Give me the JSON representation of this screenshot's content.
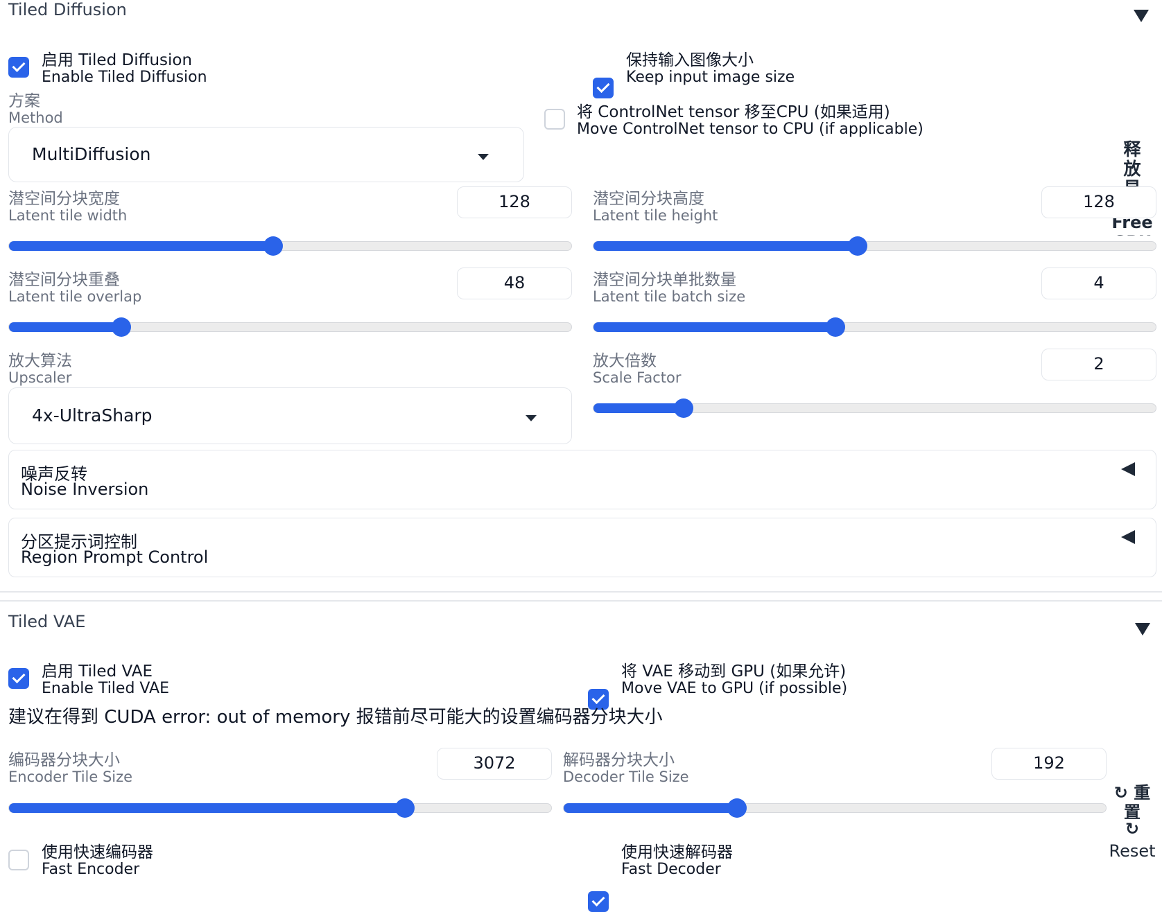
{
  "tiled_diffusion": {
    "title": "Tiled Diffusion",
    "enable": {
      "cn": "启用 Tiled Diffusion",
      "en": "Enable Tiled Diffusion",
      "checked": true
    },
    "keep_size": {
      "cn": "保持输入图像大小",
      "en": "Keep input image size",
      "checked": true
    },
    "controlnet_cpu": {
      "cn": "将 ControlNet tensor 移至CPU (如果适用)",
      "en": "Move ControlNet tensor to CPU (if applicable)",
      "checked": false
    },
    "method": {
      "cn": "方案",
      "en": "Method",
      "value": "MultiDiffusion"
    },
    "free_gpu": {
      "cn": "释放显",
      "en": "Free GPU"
    },
    "tile_width": {
      "cn": "潜空间分块宽度",
      "en": "Latent tile width",
      "value": "128",
      "fraction": 0.47
    },
    "tile_height": {
      "cn": "潜空间分块高度",
      "en": "Latent tile height",
      "value": "128",
      "fraction": 0.47
    },
    "tile_overlap": {
      "cn": "潜空间分块重叠",
      "en": "Latent tile overlap",
      "value": "48",
      "fraction": 0.2
    },
    "batch_size": {
      "cn": "潜空间分块单批数量",
      "en": "Latent tile batch size",
      "value": "4",
      "fraction": 0.43
    },
    "upscaler": {
      "cn": "放大算法",
      "en": "Upscaler",
      "value": "4x-UltraSharp"
    },
    "scale_factor": {
      "cn": "放大倍数",
      "en": "Scale Factor",
      "value": "2",
      "fraction": 0.16
    },
    "noise_inversion": {
      "cn": "噪声反转",
      "en": "Noise Inversion"
    },
    "region_prompt": {
      "cn": "分区提示词控制",
      "en": "Region Prompt Control"
    }
  },
  "tiled_vae": {
    "title": "Tiled VAE",
    "enable": {
      "cn": "启用 Tiled VAE",
      "en": "Enable Tiled VAE",
      "checked": true
    },
    "vae_gpu": {
      "cn": "将 VAE 移动到 GPU (如果允许)",
      "en": "Move VAE to GPU (if possible)",
      "checked": true
    },
    "hint": "建议在得到 CUDA error: out of memory 报错前尽可能大的设置编码器分块大小",
    "encoder_tile": {
      "cn": "编码器分块大小",
      "en": "Encoder Tile Size",
      "value": "3072",
      "fraction": 0.73
    },
    "decoder_tile": {
      "cn": "解码器分块大小",
      "en": "Decoder Tile Size",
      "value": "192",
      "fraction": 0.32
    },
    "reset": {
      "cn_1": "↻ 重",
      "cn_2": "置",
      "cn_3": "↻",
      "en": "Reset"
    },
    "fast_encoder": {
      "cn": "使用快速编码器",
      "en": "Fast Encoder",
      "checked": false
    },
    "fast_decoder": {
      "cn": "使用快速解码器",
      "en": "Fast Decoder",
      "checked": true
    }
  },
  "colors": {
    "accent": "#2a63e9",
    "track": "#ececec",
    "border": "#e3e6eb"
  }
}
